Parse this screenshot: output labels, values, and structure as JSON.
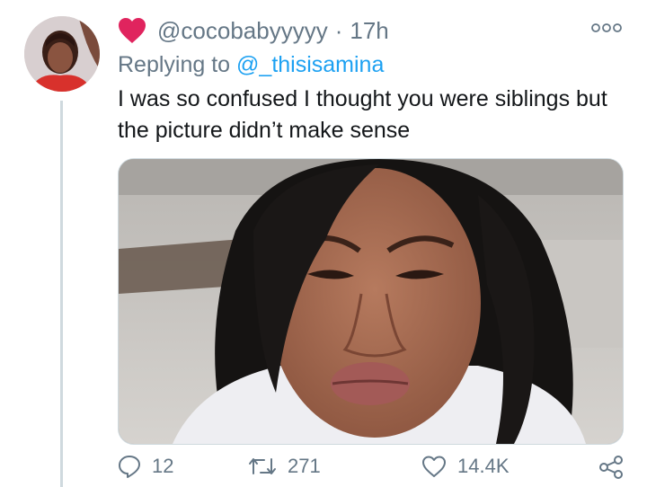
{
  "tweet": {
    "username": "@cocobabyyyyy",
    "separator": "·",
    "time": "17h",
    "replying_prefix": "Replying to ",
    "replying_to": "@_thisisamina",
    "text_line1": "I was so confused I thought you were siblings but",
    "text_line2": "the picture didn’t make sense",
    "icons": {
      "badge": "heart-icon",
      "more": "more-options-icon",
      "reply": "reply-icon",
      "retweet": "retweet-icon",
      "like": "like-icon",
      "share": "share-icon"
    },
    "colors": {
      "heart": "#e0245e",
      "mention": "#1da1f2",
      "secondary_text": "#657786",
      "thread_line": "#cfd9de"
    }
  },
  "actions": {
    "replies": "12",
    "retweets": "271",
    "likes": "14.4K"
  }
}
